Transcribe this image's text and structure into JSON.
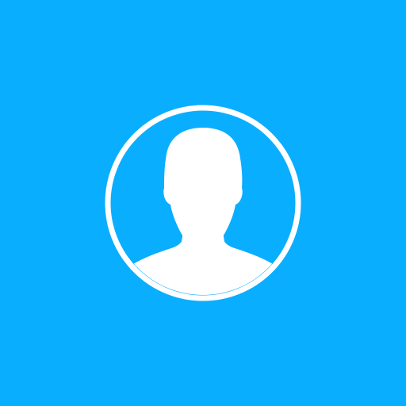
{
  "colors": {
    "background": "#0AAEFF",
    "foreground": "#FFFFFF"
  },
  "icon": "user-avatar-icon"
}
